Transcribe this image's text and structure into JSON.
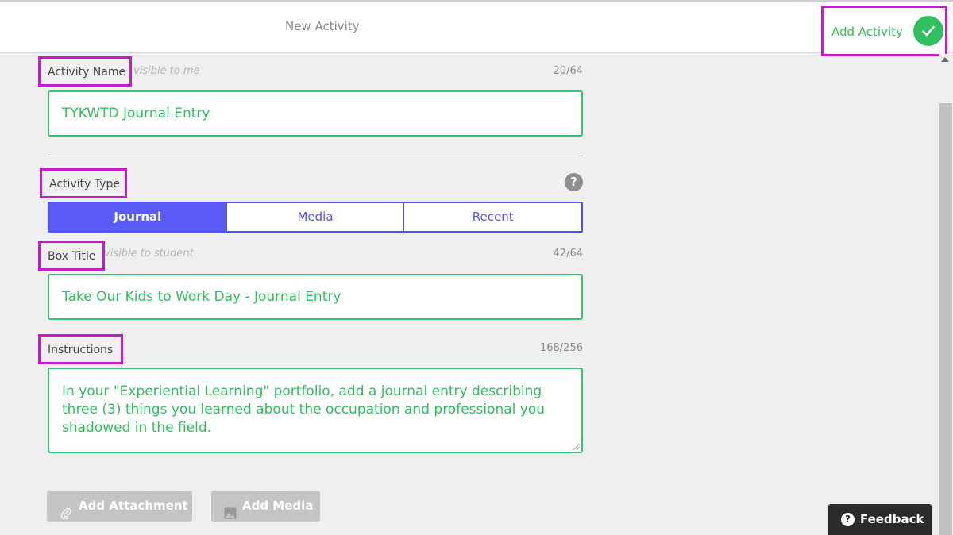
{
  "header": {
    "title": "New Activity",
    "add_label": "Add Activity"
  },
  "activity_name": {
    "label": "Activity Name",
    "hint": "visible to me",
    "counter": "20/64",
    "value": "TYKWTD Journal Entry"
  },
  "activity_type": {
    "label": "Activity Type",
    "help": "?",
    "tabs": [
      "Journal",
      "Media",
      "Recent"
    ],
    "selected": "Journal"
  },
  "box_title": {
    "label": "Box Title",
    "hint": "visible to student",
    "counter": "42/64",
    "value": "Take Our Kids to Work Day - Journal Entry"
  },
  "instructions": {
    "label": "Instructions",
    "counter": "168/256",
    "value": "In your \"Experiential Learning\" portfolio, add a journal entry describing three (3) things you learned about the occupation and professional you shadowed in the field."
  },
  "buttons": {
    "attachment": "Add Attachment",
    "media": "Add Media"
  },
  "feedback": {
    "label": "Feedback",
    "icon": "?"
  },
  "colors": {
    "accent_green": "#2fbf5f",
    "highlight": "#c51bc8",
    "tab_blue": "#5353f0"
  }
}
